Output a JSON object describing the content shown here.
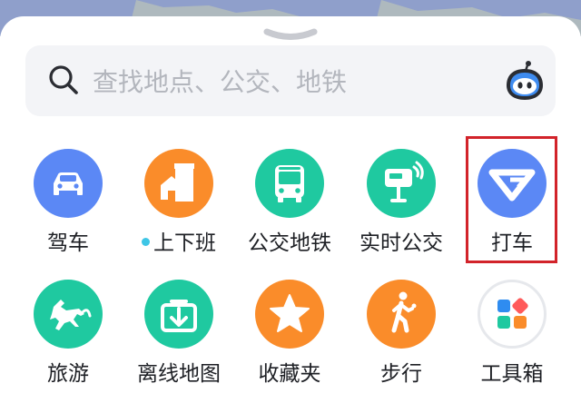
{
  "search": {
    "placeholder": "查找地点、公交、地铁"
  },
  "tiles": [
    {
      "label": "驾车",
      "icon": "car-icon",
      "color": "#5b88f5"
    },
    {
      "label": "上下班",
      "icon": "commute-house-icon",
      "color": "#fa8c2a",
      "indicator": true
    },
    {
      "label": "公交地铁",
      "icon": "bus-icon",
      "color": "#1fc9a0"
    },
    {
      "label": "实时公交",
      "icon": "realtime-bus-stop-icon",
      "color": "#1fc9a0"
    },
    {
      "label": "打车",
      "icon": "taxi-logo-icon",
      "color": "#5b88f5",
      "highlighted": true
    },
    {
      "label": "旅游",
      "icon": "horse-icon",
      "color": "#1fc9a0"
    },
    {
      "label": "离线地图",
      "icon": "download-icon",
      "color": "#1fc9a0"
    },
    {
      "label": "收藏夹",
      "icon": "star-icon",
      "color": "#fa8c2a"
    },
    {
      "label": "步行",
      "icon": "walking-person-icon",
      "color": "#fa8c2a"
    },
    {
      "label": "工具箱",
      "icon": "toolbox-grid-icon",
      "color": "#ffffff"
    }
  ],
  "colors": {
    "accent_blue": "#5b88f5",
    "green": "#1fc9a0",
    "orange": "#fa8c2a",
    "highlight_border": "#d2232a"
  }
}
